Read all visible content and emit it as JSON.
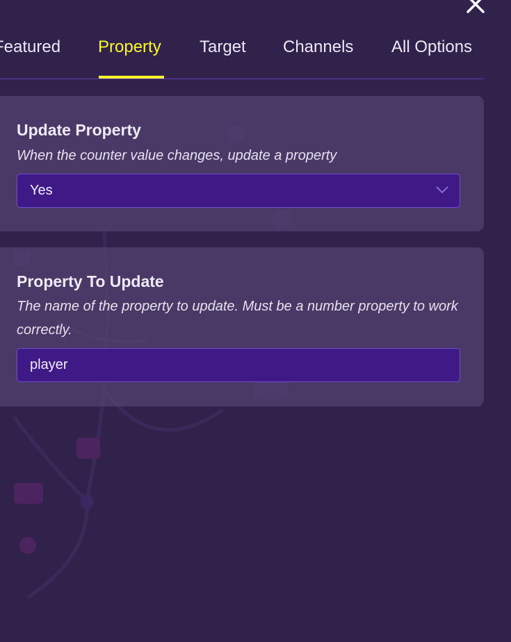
{
  "colors": {
    "background": "#31224c",
    "accent": "#fafa2a",
    "card": "#4a3a66",
    "field": "#3f1a86",
    "field_border": "#6e4fd2",
    "text": "#ece8f4"
  },
  "header": {
    "close_icon": "close-icon"
  },
  "tabs": [
    {
      "label": "Featured",
      "active": false
    },
    {
      "label": "Property",
      "active": true
    },
    {
      "label": "Target",
      "active": false
    },
    {
      "label": "Channels",
      "active": false
    },
    {
      "label": "All Options",
      "active": false
    }
  ],
  "settings": {
    "update_property": {
      "title": "Update Property",
      "description": "When the counter value changes, update a property",
      "value": "Yes",
      "icon": "chevron-down-icon"
    },
    "property_to_update": {
      "title": "Property To Update",
      "description": "The name of the property to update. Must be a number property to work correctly.",
      "value": "player"
    }
  }
}
